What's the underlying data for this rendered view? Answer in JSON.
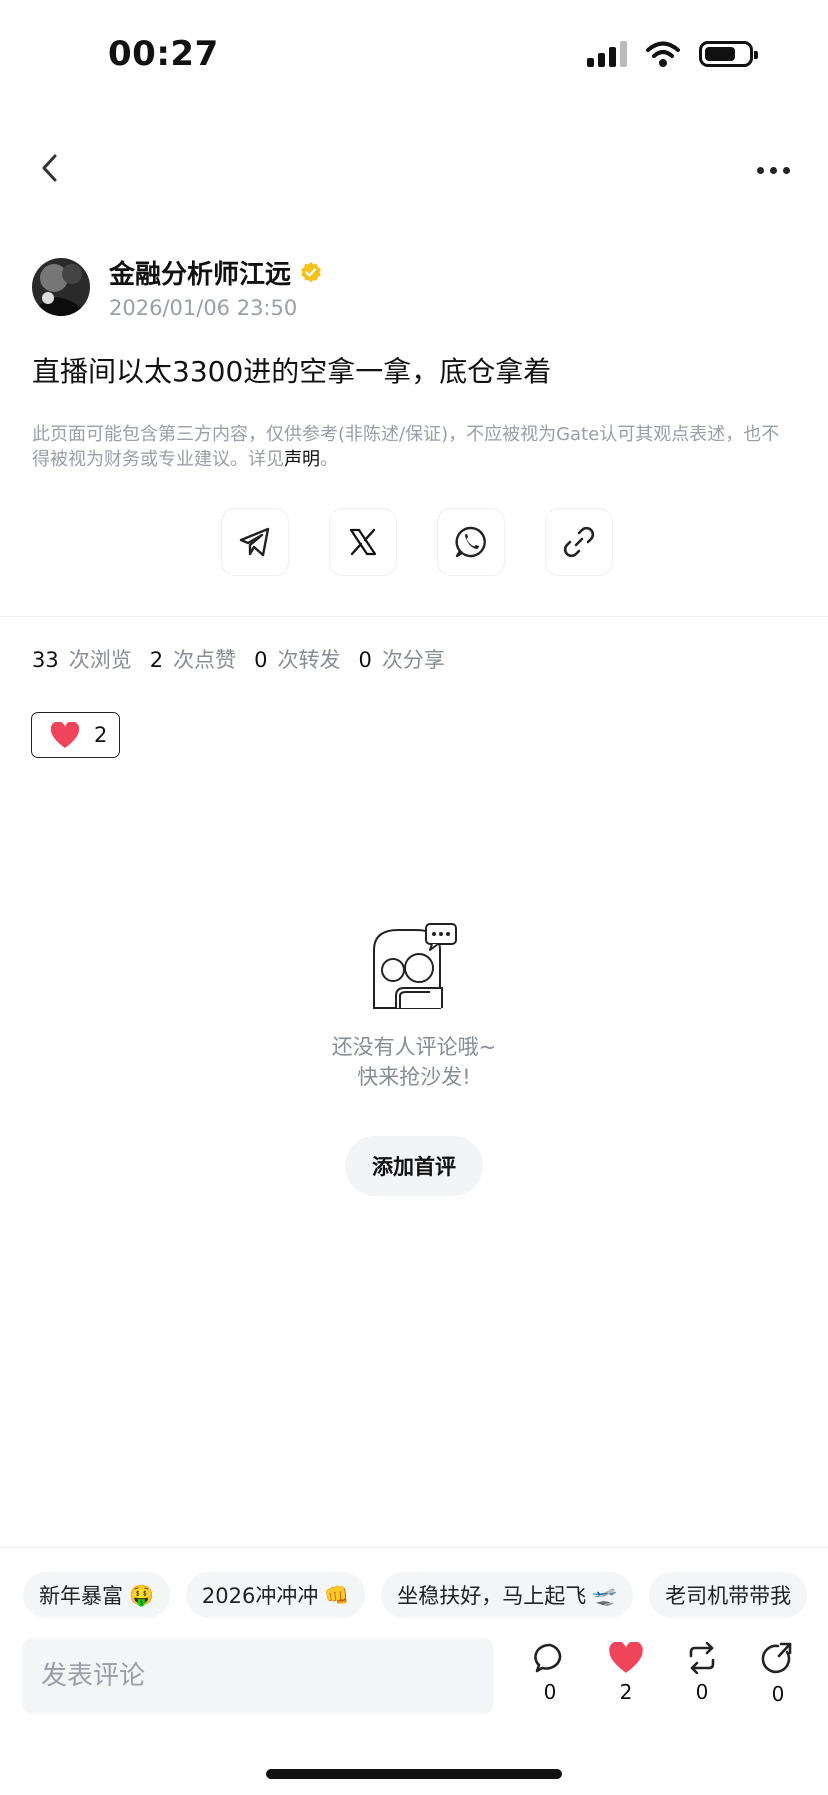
{
  "status_bar": {
    "time": "00:27",
    "icons": [
      "cellular-signal-icon",
      "wifi-icon",
      "battery-icon"
    ]
  },
  "nav": {
    "back_icon": "chevron-left-icon",
    "more_icon": "more-dots-icon"
  },
  "author": {
    "name": "金融分析师江远",
    "verified_icon": "verified-badge-icon",
    "verified_color": "#F5C21B",
    "timestamp": "2026/01/06 23:50"
  },
  "post": {
    "content": "直播间以太3300进的空拿一拿，底仓拿着"
  },
  "disclaimer": {
    "text": "此页面可能包含第三方内容，仅供参考(非陈述/保证)，不应被视为Gate认可其观点表述，也不得被视为财务或专业建议。详见",
    "link": "声明",
    "suffix": "。"
  },
  "share": {
    "icons": [
      "telegram-icon",
      "x-icon",
      "whatsapp-icon",
      "link-icon"
    ]
  },
  "stats": {
    "views": "33",
    "views_label": "次浏览",
    "likes": "2",
    "likes_label": "次点赞",
    "reposts": "0",
    "reposts_label": "次转发",
    "shares": "0",
    "shares_label": "次分享"
  },
  "reaction": {
    "icon": "heart-icon",
    "count": "2",
    "heart_color": "#F0445B"
  },
  "empty_state": {
    "line1": "还没有人评论哦~",
    "line2": "快来抢沙发!",
    "button": "添加首评"
  },
  "chips": [
    {
      "label": "新年暴富",
      "emoji": "🤑"
    },
    {
      "label": "2026冲冲冲",
      "emoji": "👊"
    },
    {
      "label": "坐稳扶好，马上起飞",
      "emoji": "🛫"
    },
    {
      "label": "老司机带带我",
      "emoji": ""
    }
  ],
  "comment_bar": {
    "placeholder": "发表评论",
    "comment_count": "0",
    "like_count": "2",
    "repost_count": "0",
    "share_count": "0"
  }
}
